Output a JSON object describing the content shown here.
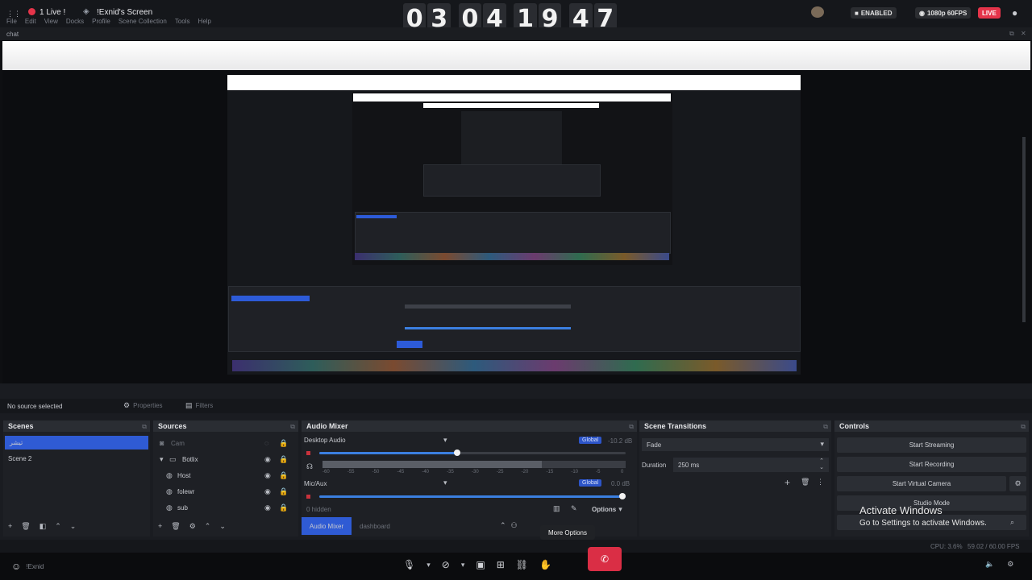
{
  "topbar": {
    "live_count": "1 Live !",
    "screen_name": "!Exnid's Screen",
    "menu": [
      "File",
      "Edit",
      "View",
      "Docks",
      "Profile",
      "Scene Collection",
      "Tools",
      "Help"
    ],
    "timer_digits": [
      "0",
      "3",
      "0",
      "4",
      "1",
      "9",
      "4",
      "7"
    ],
    "enabled_badge": "ENABLED",
    "quality_badge": "1080p 60FPS",
    "live_badge": "LIVE"
  },
  "chat_label": "chat",
  "source_bar": {
    "no_source": "No source selected",
    "properties": "Properties",
    "filters": "Filters"
  },
  "scenes": {
    "title": "Scenes",
    "items": [
      "تيشر",
      "Scene 2"
    ]
  },
  "sources": {
    "title": "Sources",
    "items": [
      {
        "label": "Cam",
        "indent": 0
      },
      {
        "label": "Botlix",
        "indent": 1
      },
      {
        "label": "Host",
        "indent": 2
      },
      {
        "label": "folewr",
        "indent": 2
      },
      {
        "label": "sub",
        "indent": 2
      }
    ]
  },
  "audio_mixer": {
    "title": "Audio Mixer",
    "desktop_label": "Desktop Audio",
    "desktop_db": "-10.2 dB",
    "mic_label": "Mic/Aux",
    "mic_db": "0.0 dB",
    "global": "Global",
    "hidden": "0 hidden",
    "options": "Options",
    "tabs": [
      "Audio Mixer",
      "dashboard"
    ],
    "scale": [
      "-60",
      "-55",
      "-50",
      "-45",
      "-40",
      "-35",
      "-30",
      "-25",
      "-20",
      "-15",
      "-10",
      "-5",
      "0"
    ],
    "desktop_level": 0.45,
    "mic_level": 1.0
  },
  "transitions": {
    "title": "Scene Transitions",
    "transition": "Fade",
    "duration_label": "Duration",
    "duration_value": "250 ms"
  },
  "controls": {
    "title": "Controls",
    "buttons": [
      "Start Streaming",
      "Start Recording",
      "Start Virtual Camera",
      "Studio Mode"
    ]
  },
  "status": {
    "cpu": "CPU: 3.6%",
    "fps": "59.02 / 60.00 FPS"
  },
  "tooltip": "More Options",
  "activate": {
    "title": "Activate Windows",
    "subtitle": "Go to Settings to activate Windows."
  },
  "taskbar": {
    "user": "!Exnid"
  }
}
